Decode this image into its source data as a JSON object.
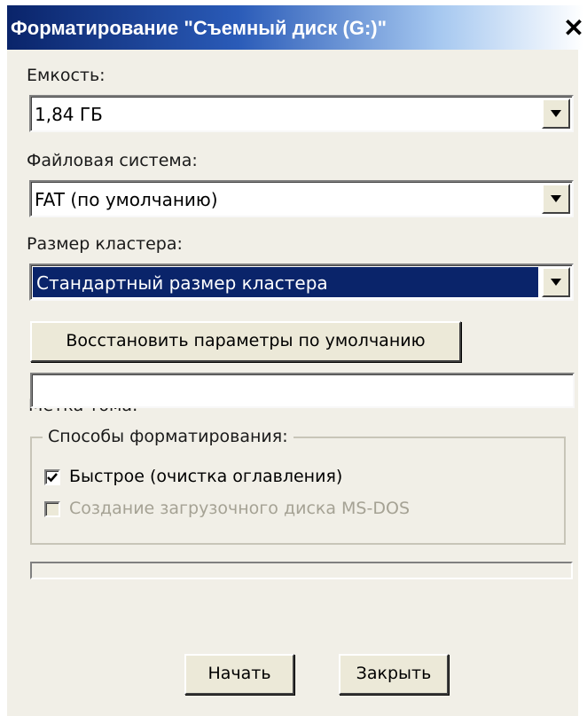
{
  "window": {
    "title": "Форматирование \"Съемный диск (G:)\"",
    "close_glyph": "✕"
  },
  "capacity": {
    "label": "Емкость:",
    "value": "1,84 ГБ"
  },
  "filesystem": {
    "label": "Файловая система:",
    "value": "FAT (по умолчанию)"
  },
  "cluster": {
    "label": "Размер кластера:",
    "value": "Стандартный размер кластера"
  },
  "restore_defaults_label": "Восстановить параметры по умолчанию",
  "volume_label": {
    "label": "Метка тома:",
    "value": ""
  },
  "format_options": {
    "group_label": "Способы форматирования:",
    "quick": {
      "label": "Быстрое (очистка оглавления)",
      "checked": true,
      "enabled": true
    },
    "msdos": {
      "label": "Создание загрузочного диска MS-DOS",
      "checked": false,
      "enabled": false
    }
  },
  "progress": {
    "fraction": 0
  },
  "buttons": {
    "start": "Начать",
    "close": "Закрыть"
  },
  "colors": {
    "selection": "#0a246a",
    "dialog_bg": "#f1efe7",
    "disabled_text": "#a5a294"
  },
  "icons": {
    "close": "close-icon",
    "dropdown": "chevron-down-icon",
    "check": "checkmark-icon"
  }
}
